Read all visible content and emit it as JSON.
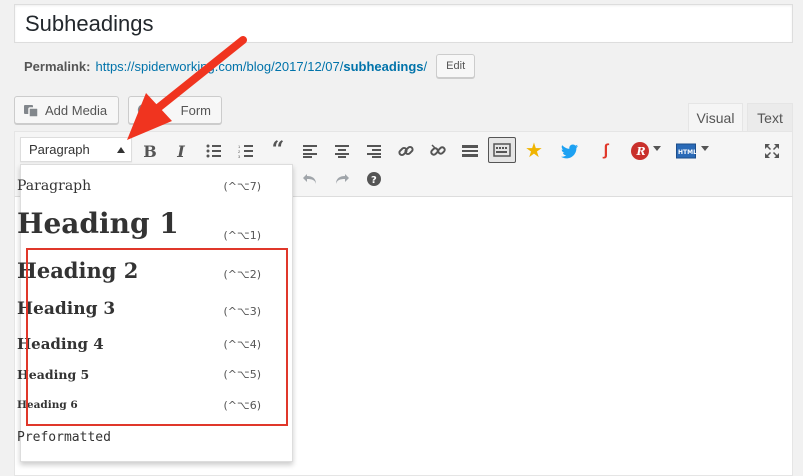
{
  "post": {
    "title": "Subheadings"
  },
  "permalink": {
    "label": "Permalink:",
    "url_base": "https://spiderworking.com/blog/2017/12/07/",
    "slug": "subheadings",
    "trailing": "/",
    "edit_label": "Edit"
  },
  "media": {
    "add_media_label": "Add Media",
    "form_label": "Form"
  },
  "tabs": {
    "visual": "Visual",
    "text": "Text"
  },
  "toolbar": {
    "format_select": "Paragraph",
    "icons": [
      "bold-icon",
      "italic-icon",
      "bulleted-list-icon",
      "numbered-list-icon",
      "blockquote-icon",
      "align-left-icon",
      "align-center-icon",
      "align-right-icon",
      "link-icon",
      "unlink-icon",
      "read-more-icon",
      "toolbar-toggle-icon",
      "star-icon",
      "twitter-icon",
      "shortlink-icon",
      "r-plugin-icon",
      "html-icon",
      "fullscreen-icon",
      "undo-icon",
      "redo-icon",
      "help-icon"
    ]
  },
  "dropdown": {
    "items": [
      {
        "label": "Paragraph",
        "shortcut": "(^⌥7)"
      },
      {
        "label": "Heading 1",
        "shortcut": "(^⌥1)"
      },
      {
        "label": "Heading 2",
        "shortcut": "(^⌥2)"
      },
      {
        "label": "Heading 3",
        "shortcut": "(^⌥3)"
      },
      {
        "label": "Heading 4",
        "shortcut": "(^⌥4)"
      },
      {
        "label": "Heading 5",
        "shortcut": "(^⌥5)"
      },
      {
        "label": "Heading 6",
        "shortcut": "(^⌥6)"
      },
      {
        "label": "Preformatted",
        "shortcut": ""
      }
    ]
  },
  "colors": {
    "accent": "#0073aa",
    "highlight": "#e0372a",
    "arrow": "#f0341f",
    "star": "#f0b400",
    "twitter": "#1da1f2"
  }
}
